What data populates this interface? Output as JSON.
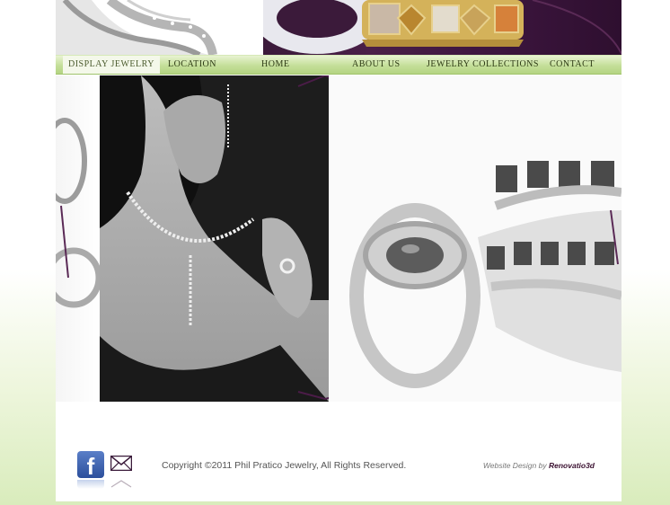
{
  "nav": {
    "items": [
      {
        "label": "Display Jewelry",
        "active": true
      },
      {
        "label": "Location"
      },
      {
        "label": "Home"
      },
      {
        "label": "About Us"
      },
      {
        "label": "Jewelry Collections"
      },
      {
        "label": "Contact"
      }
    ]
  },
  "footer": {
    "copyright": "Copyright ©2011 Phil Pratico Jewelry, All Rights Reserved.",
    "credit_prefix": "Website Design by",
    "credit_link": "Renovatio3d",
    "social": {
      "facebook_glyph": "f"
    }
  },
  "colors": {
    "nav_green": "#c4df99",
    "brand_purple": "#3b1a3a",
    "page_bg_bottom": "#d9ecbc"
  },
  "icons": [
    "facebook-icon",
    "mail-icon"
  ]
}
